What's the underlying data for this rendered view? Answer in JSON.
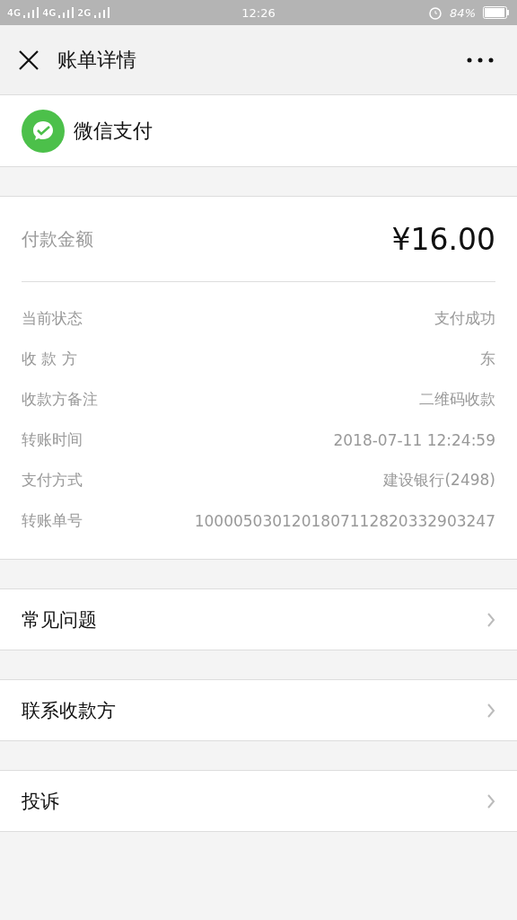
{
  "status_bar": {
    "networks": [
      "4G",
      "4G",
      "2G"
    ],
    "time": "12:26",
    "battery": "84%"
  },
  "nav": {
    "title": "账单详情"
  },
  "merchant": {
    "name": "微信支付"
  },
  "amount": {
    "label": "付款金额",
    "value": "¥16.00"
  },
  "details": [
    {
      "label": "当前状态",
      "value": "支付成功"
    },
    {
      "label": "收 款 方",
      "value": "东"
    },
    {
      "label": "收款方备注",
      "value": "二维码收款"
    },
    {
      "label": "转账时间",
      "value": "2018-07-11 12:24:59"
    },
    {
      "label": "支付方式",
      "value": "建设银行(2498)"
    },
    {
      "label": "转账单号",
      "value": "1000050301201807112820332903247"
    }
  ],
  "links": [
    "常见问题",
    "联系收款方",
    "投诉"
  ]
}
